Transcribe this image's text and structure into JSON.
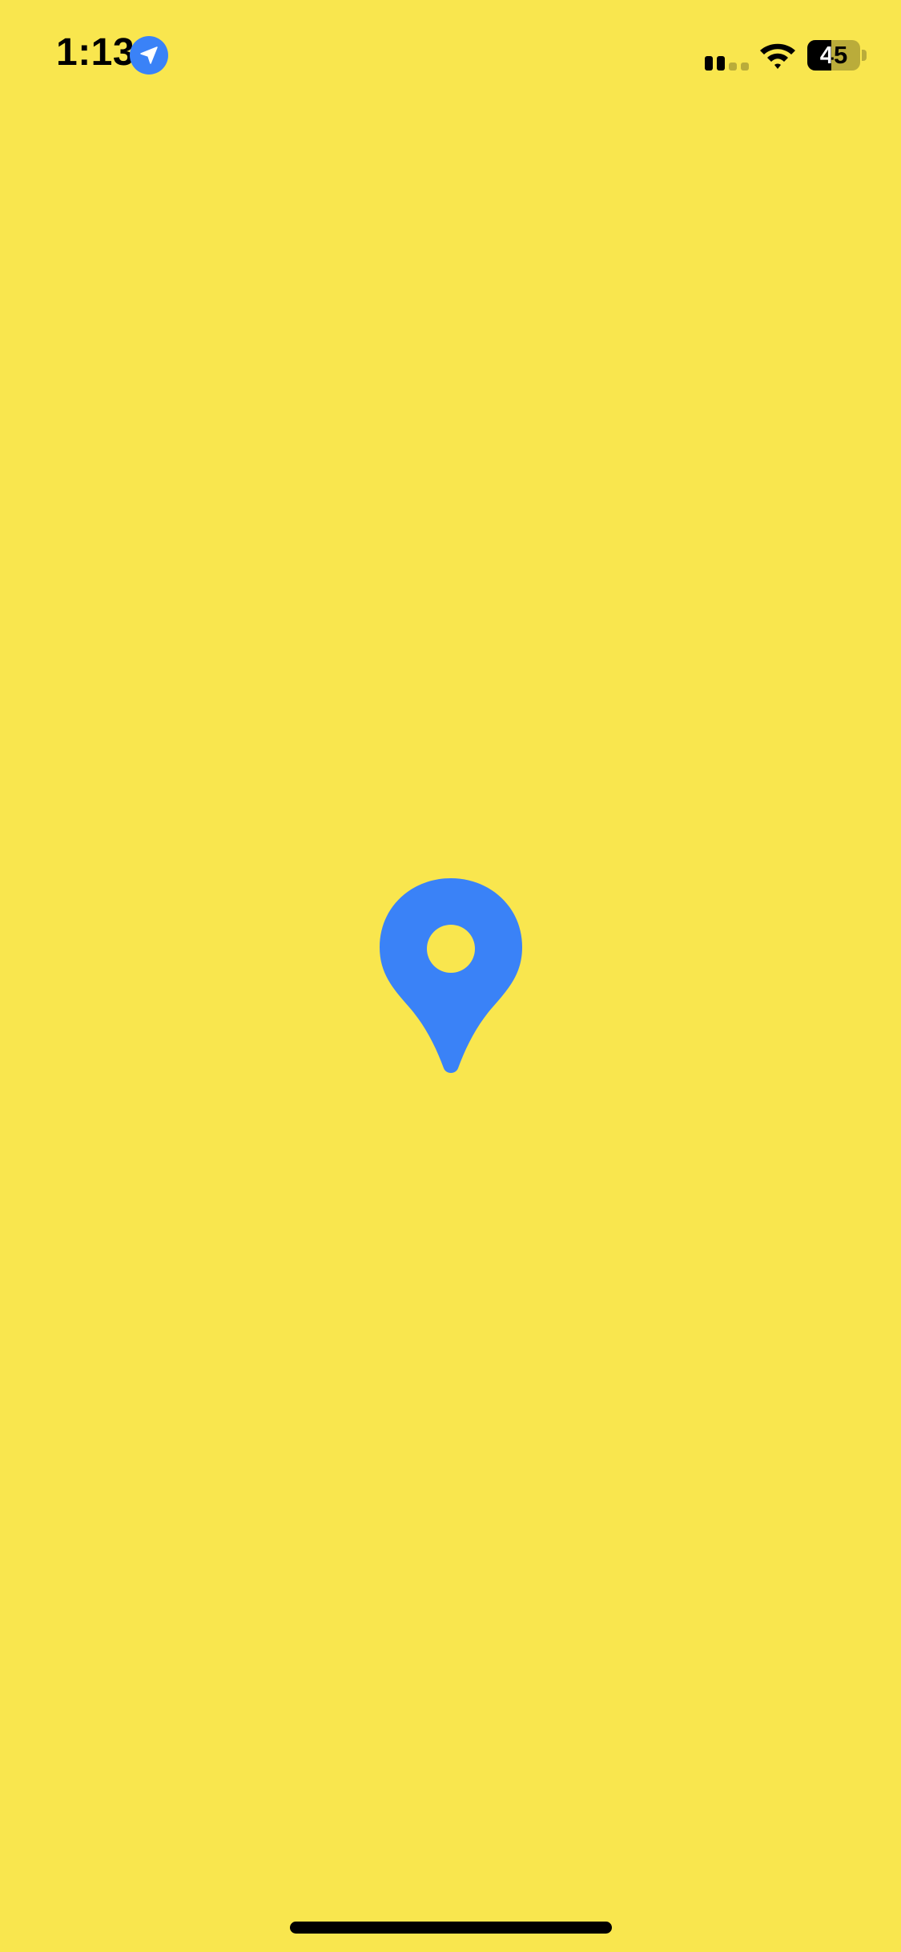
{
  "theme": {
    "background": "#F9E64E",
    "accent": "#3A82F7",
    "foreground": "#000000"
  },
  "status_bar": {
    "time": "1:13",
    "location_icon": "location-arrow-icon",
    "signal_icon": "cellular-signal-icon",
    "signal_bars_active": 2,
    "signal_bars_total": 4,
    "wifi_icon": "wifi-icon",
    "battery_icon": "battery-icon",
    "battery_percent": "45",
    "battery_level": 0.45
  },
  "splash": {
    "icon": "map-pin-icon"
  },
  "home_indicator": {
    "icon": "home-indicator-bar"
  }
}
